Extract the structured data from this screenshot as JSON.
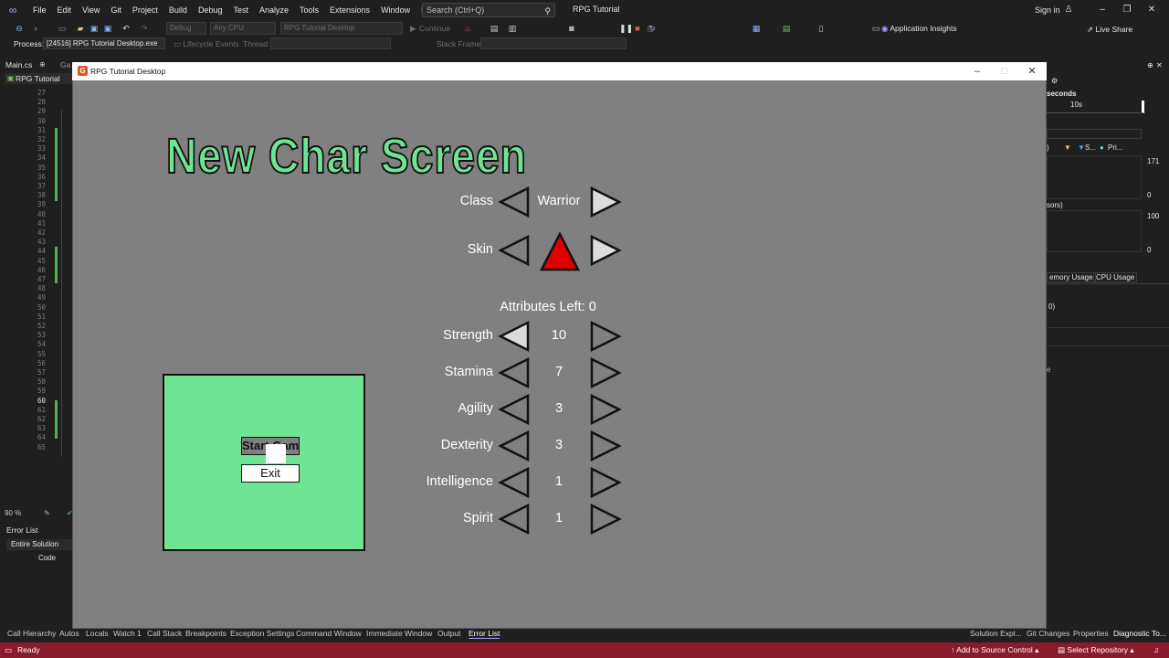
{
  "vs": {
    "menus": [
      "File",
      "Edit",
      "View",
      "Git",
      "Project",
      "Build",
      "Debug",
      "Test",
      "Analyze",
      "Tools",
      "Extensions",
      "Window",
      "Help"
    ],
    "search_placeholder": "Search (Ctrl+Q)",
    "project_title": "RPG Tutorial",
    "sign_in": "Sign in",
    "config": "Debug",
    "platform": "Any CPU",
    "startup": "RPG Tutorial Desktop",
    "continue_label": "Continue",
    "app_insights": "Application Insights",
    "live_share": "Live Share",
    "process_label": "Process:",
    "process_value": "[24516] RPG Tutorial Desktop.exe",
    "lifecycle": "Lifecycle Events",
    "thread": "Thread:",
    "stack_frame": "Stack Frame:",
    "tab_main": "Main.cs",
    "tab_game": "Ga",
    "crumb": "RPG Tutorial",
    "line_numbers": [
      "27",
      "28",
      "29",
      "30",
      "31",
      "32",
      "33",
      "34",
      "35",
      "36",
      "37",
      "38",
      "39",
      "40",
      "41",
      "42",
      "43",
      "44",
      "45",
      "46",
      "47",
      "48",
      "49",
      "50",
      "51",
      "52",
      "53",
      "54",
      "55",
      "56",
      "57",
      "58",
      "59",
      "60",
      "61",
      "62",
      "63",
      "64",
      "65"
    ],
    "zoom": "90 %",
    "error_list": "Error List",
    "error_scope": "Entire Solution",
    "error_col_code": "Code",
    "diag": {
      "seconds": "seconds",
      "tick": "10s",
      "val_171": "171",
      "val_0a": "0",
      "val_100": "100",
      "val_0b": "0",
      "sors": "sors)",
      "legend_s": "S...",
      "legend_pri": "Pri...",
      "paren": ")",
      "memory_tab": "emory Usage",
      "cpu_tab": "CPU Usage",
      "zero_paren": "0)",
      "e": "e"
    },
    "bottom_tabs": [
      "Call Hierarchy",
      "Autos",
      "Locals",
      "Watch 1",
      "Call Stack",
      "Breakpoints",
      "Exception Settings",
      "Command Window",
      "Immediate Window",
      "Output",
      "Error List"
    ],
    "right_tabs": [
      "Solution Expl...",
      "Git Changes",
      "Properties",
      "Diagnostic To..."
    ],
    "status_ready": "Ready",
    "status_source": "Add to Source Control",
    "status_repo": "Select Repository"
  },
  "game": {
    "window_title": "RPG Tutorial Desktop",
    "headline": "New Char Screen",
    "class_label": "Class",
    "class_value": "Warrior",
    "skin_label": "Skin",
    "attributes_left": "Attributes Left: 0",
    "stats": [
      {
        "label": "Strength",
        "value": "10"
      },
      {
        "label": "Stamina",
        "value": "7"
      },
      {
        "label": "Agility",
        "value": "3"
      },
      {
        "label": "Dexterity",
        "value": "3"
      },
      {
        "label": "Intelligence",
        "value": "1"
      },
      {
        "label": "Spirit",
        "value": "1"
      }
    ],
    "start_button": "Start Game",
    "exit_button": "Exit",
    "colors": {
      "panel": "#6ee494",
      "background": "#808080",
      "skin": "#e00000"
    }
  }
}
